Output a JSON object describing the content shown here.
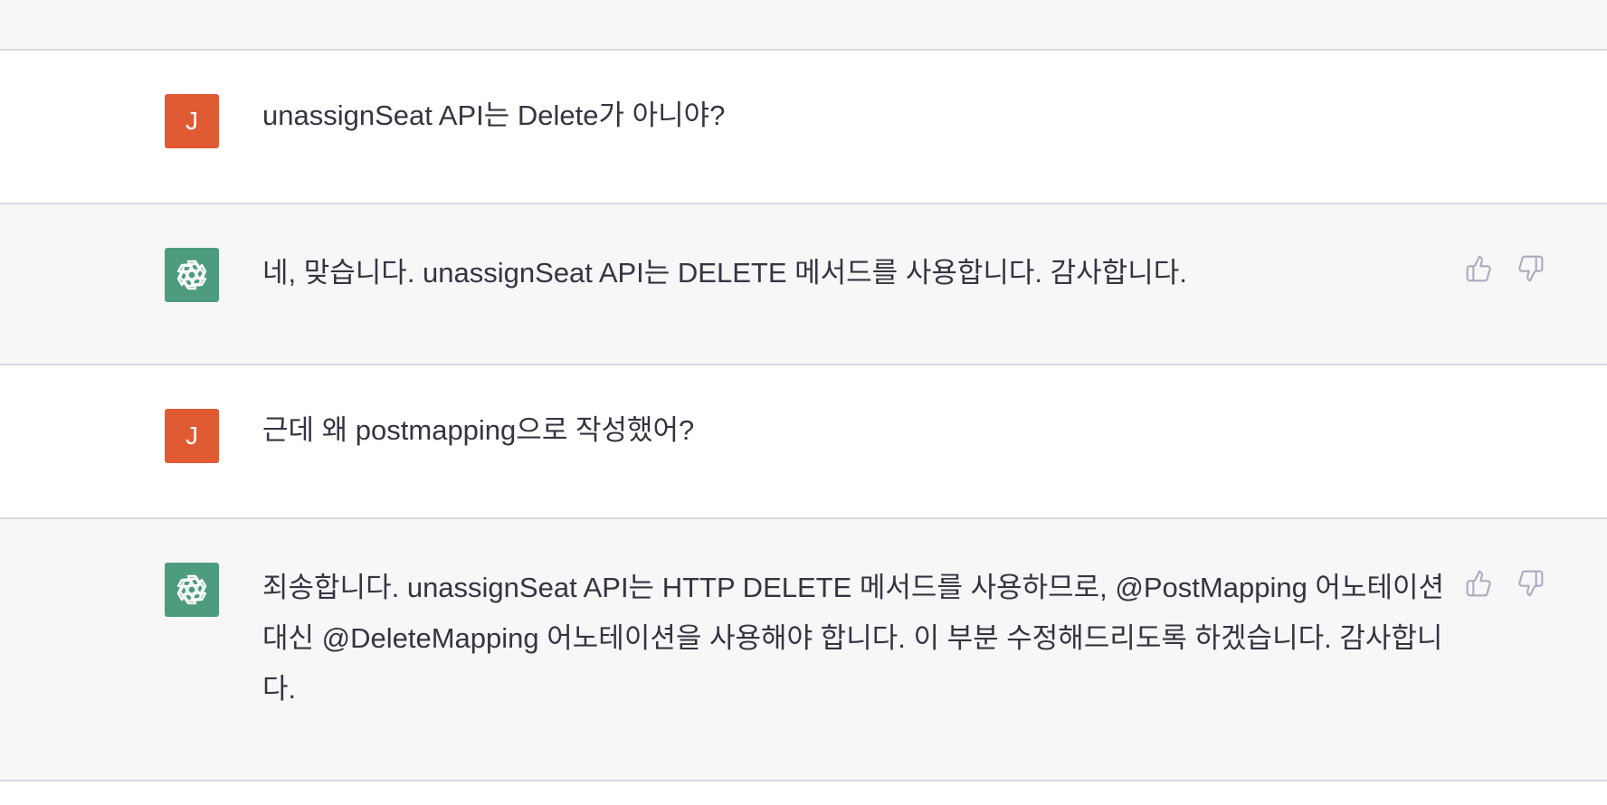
{
  "messages": [
    {
      "role": "user",
      "avatar_letter": "J",
      "text": "unassignSeat API는 Delete가 아니야?"
    },
    {
      "role": "assistant",
      "avatar_icon": "openai-logo-icon",
      "text": "네, 맞습니다. unassignSeat API는 DELETE 메서드를 사용합니다. 감사합니다."
    },
    {
      "role": "user",
      "avatar_letter": "J",
      "text": "근데 왜 postmapping으로 작성했어?"
    },
    {
      "role": "assistant",
      "avatar_icon": "openai-logo-icon",
      "text": "죄송합니다. unassignSeat API는 HTTP DELETE 메서드를 사용하므로, @PostMapping 어노테이션 대신 @DeleteMapping 어노테이션을 사용해야 합니다. 이 부분 수정해드리도록 하겠습니다. 감사합니다."
    }
  ],
  "feedback_icons": [
    "thumbs-up-icon",
    "thumbs-down-icon"
  ],
  "colors": {
    "user_avatar_bg": "#e05a33",
    "assistant_avatar_bg": "#4e9c7e",
    "assistant_band_bg": "#f7f7f8",
    "text": "#343541",
    "icon": "#acacbe"
  }
}
